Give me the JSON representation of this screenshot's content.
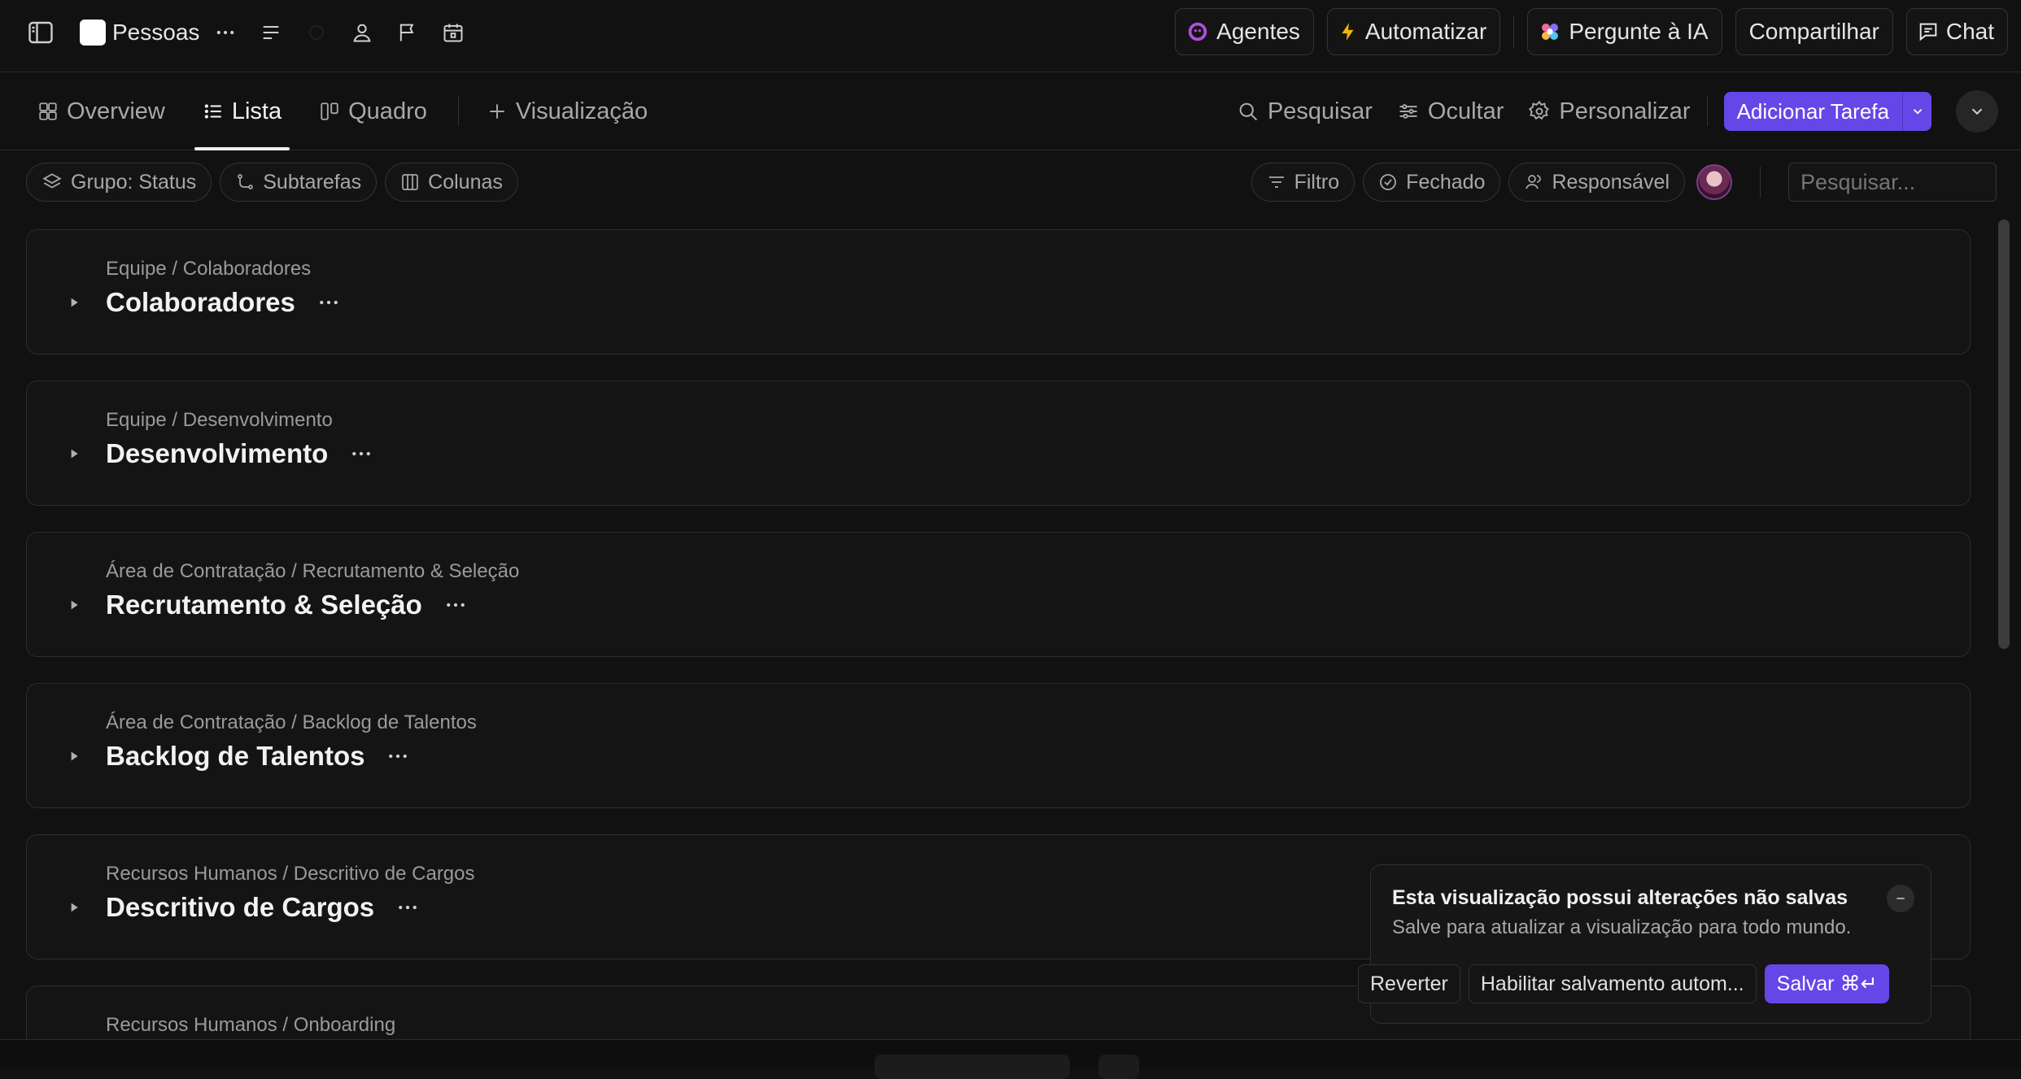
{
  "topbar": {
    "space_name": "Pessoas",
    "agents_label": "Agentes",
    "automate_label": "Automatizar",
    "ask_ai_label": "Pergunte à IA",
    "share_label": "Compartilhar",
    "chat_label": "Chat"
  },
  "viewbar": {
    "tabs": [
      {
        "label": "Overview",
        "icon": "grid-icon",
        "active": false
      },
      {
        "label": "Lista",
        "icon": "list-icon",
        "active": true
      },
      {
        "label": "Quadro",
        "icon": "board-icon",
        "active": false
      }
    ],
    "add_view_label": "Visualização",
    "search_label": "Pesquisar",
    "hide_label": "Ocultar",
    "customize_label": "Personalizar",
    "add_task_label": "Adicionar Tarefa"
  },
  "filters": {
    "group_label": "Grupo: Status",
    "subtasks_label": "Subtarefas",
    "columns_label": "Colunas",
    "filter_label": "Filtro",
    "closed_label": "Fechado",
    "assignee_label": "Responsável",
    "search_placeholder": "Pesquisar..."
  },
  "groups": [
    {
      "path": "Equipe / Colaboradores",
      "title": "Colaboradores"
    },
    {
      "path": "Equipe / Desenvolvimento",
      "title": "Desenvolvimento"
    },
    {
      "path": "Área de Contratação / Recrutamento & Seleção",
      "title": "Recrutamento & Seleção"
    },
    {
      "path": "Área de Contratação / Backlog de Talentos",
      "title": "Backlog de Talentos"
    },
    {
      "path": "Recursos Humanos / Descritivo de Cargos",
      "title": "Descritivo de Cargos"
    },
    {
      "path": "Recursos Humanos / Onboarding",
      "title": ""
    }
  ],
  "toast": {
    "title": "Esta visualização possui alterações não salvas",
    "description": "Salve para atualizar a visualização para todo mundo.",
    "revert_label": "Reverter",
    "autosave_label": "Habilitar salvamento autom...",
    "save_label": "Salvar ⌘↵"
  },
  "colors": {
    "accent": "#6547e8",
    "background": "#111111",
    "card": "#141414"
  }
}
